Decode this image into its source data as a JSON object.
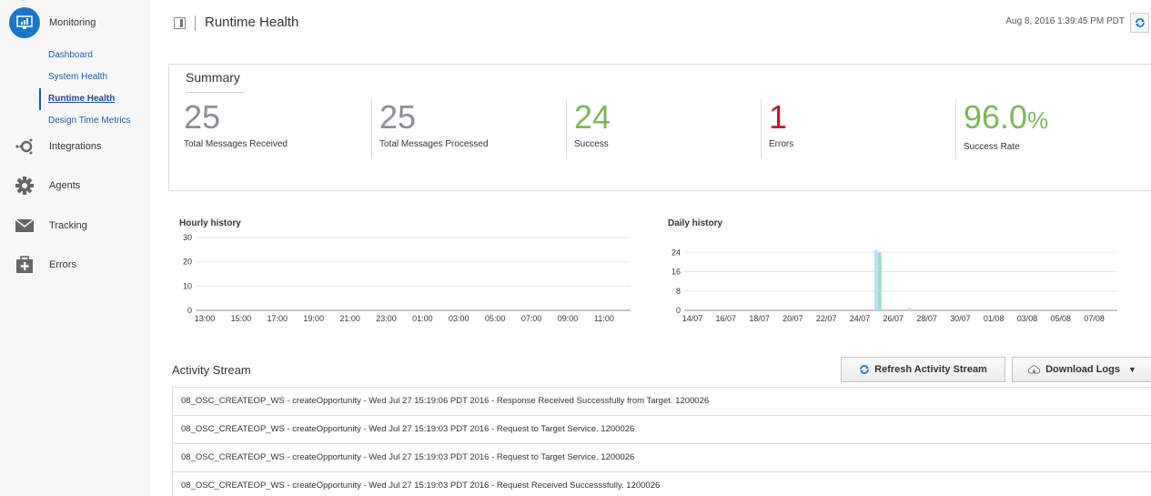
{
  "sidebar": {
    "monitoring_label": "Monitoring",
    "monitoring_items": [
      {
        "label": "Dashboard",
        "active": false
      },
      {
        "label": "System Health",
        "active": false
      },
      {
        "label": "Runtime Health",
        "active": true
      },
      {
        "label": "Design Time Metrics",
        "active": false
      }
    ],
    "nav": [
      {
        "label": "Integrations",
        "icon": "integrations-icon"
      },
      {
        "label": "Agents",
        "icon": "gear-icon"
      },
      {
        "label": "Tracking",
        "icon": "envelope-icon"
      },
      {
        "label": "Errors",
        "icon": "first-aid-kit-icon"
      }
    ]
  },
  "header": {
    "title": "Runtime Health",
    "timestamp": "Aug 8, 2016 1:39:45 PM PDT"
  },
  "summary": {
    "title": "Summary",
    "metrics": [
      {
        "value": "25",
        "label": "Total Messages Received",
        "color": "#8a9097"
      },
      {
        "value": "25",
        "label": "Total Messages Processed",
        "color": "#8a9097"
      },
      {
        "value": "24",
        "label": "Success",
        "color": "#7fb55a"
      },
      {
        "value": "1",
        "label": "Errors",
        "color": "#c8102e"
      },
      {
        "value": "96.0",
        "unit": "%",
        "label": "Success Rate",
        "color": "#7fb55a"
      }
    ]
  },
  "chart_data": [
    {
      "type": "bar",
      "title": "Hourly history",
      "categories": [
        "13:00",
        "15:00",
        "17:00",
        "19:00",
        "21:00",
        "23:00",
        "01:00",
        "03:00",
        "05:00",
        "07:00",
        "09:00",
        "11:00"
      ],
      "yticks": [
        0,
        10,
        20,
        30
      ],
      "ylim": [
        0,
        30
      ],
      "series": [
        {
          "values": [
            0,
            0,
            0,
            0,
            0,
            0,
            0,
            0,
            0,
            0,
            0,
            0
          ]
        }
      ]
    },
    {
      "type": "bar",
      "title": "Daily history",
      "categories": [
        "14/07",
        "16/07",
        "18/07",
        "20/07",
        "22/07",
        "24/07",
        "26/07",
        "28/07",
        "30/07",
        "01/08",
        "03/08",
        "05/08",
        "07/08"
      ],
      "yticks": [
        0,
        8,
        16,
        24
      ],
      "ylim": [
        0,
        26
      ],
      "series": [
        {
          "values": [
            0,
            0,
            0,
            0,
            0,
            0,
            25,
            1,
            0,
            0,
            0,
            0,
            0
          ],
          "color": "#b9e1f3"
        },
        {
          "values": [
            0,
            0,
            0,
            0,
            0,
            0,
            24,
            0,
            0,
            0,
            0,
            0,
            0
          ],
          "color": "#9fdcc6"
        }
      ]
    }
  ],
  "activity": {
    "title": "Activity Stream",
    "refresh_label": "Refresh Activity Stream",
    "download_label": "Download Logs",
    "rows": [
      "08_OSC_CREATEOP_WS - createOpportunity - Wed Jul 27 15:19:06 PDT 2016 - Response Received Successfully from Target. 1200026",
      "08_OSC_CREATEOP_WS - createOpportunity - Wed Jul 27 15:19:03 PDT 2016 - Request to Target Service. 1200026",
      "08_OSC_CREATEOP_WS - createOpportunity - Wed Jul 27 15:19:03 PDT 2016 - Request to Target Service. 1200026",
      "08_OSC_CREATEOP_WS - createOpportunity - Wed Jul 27 15:19:03 PDT 2016 - Request Received Successsfully. 1200026"
    ]
  }
}
